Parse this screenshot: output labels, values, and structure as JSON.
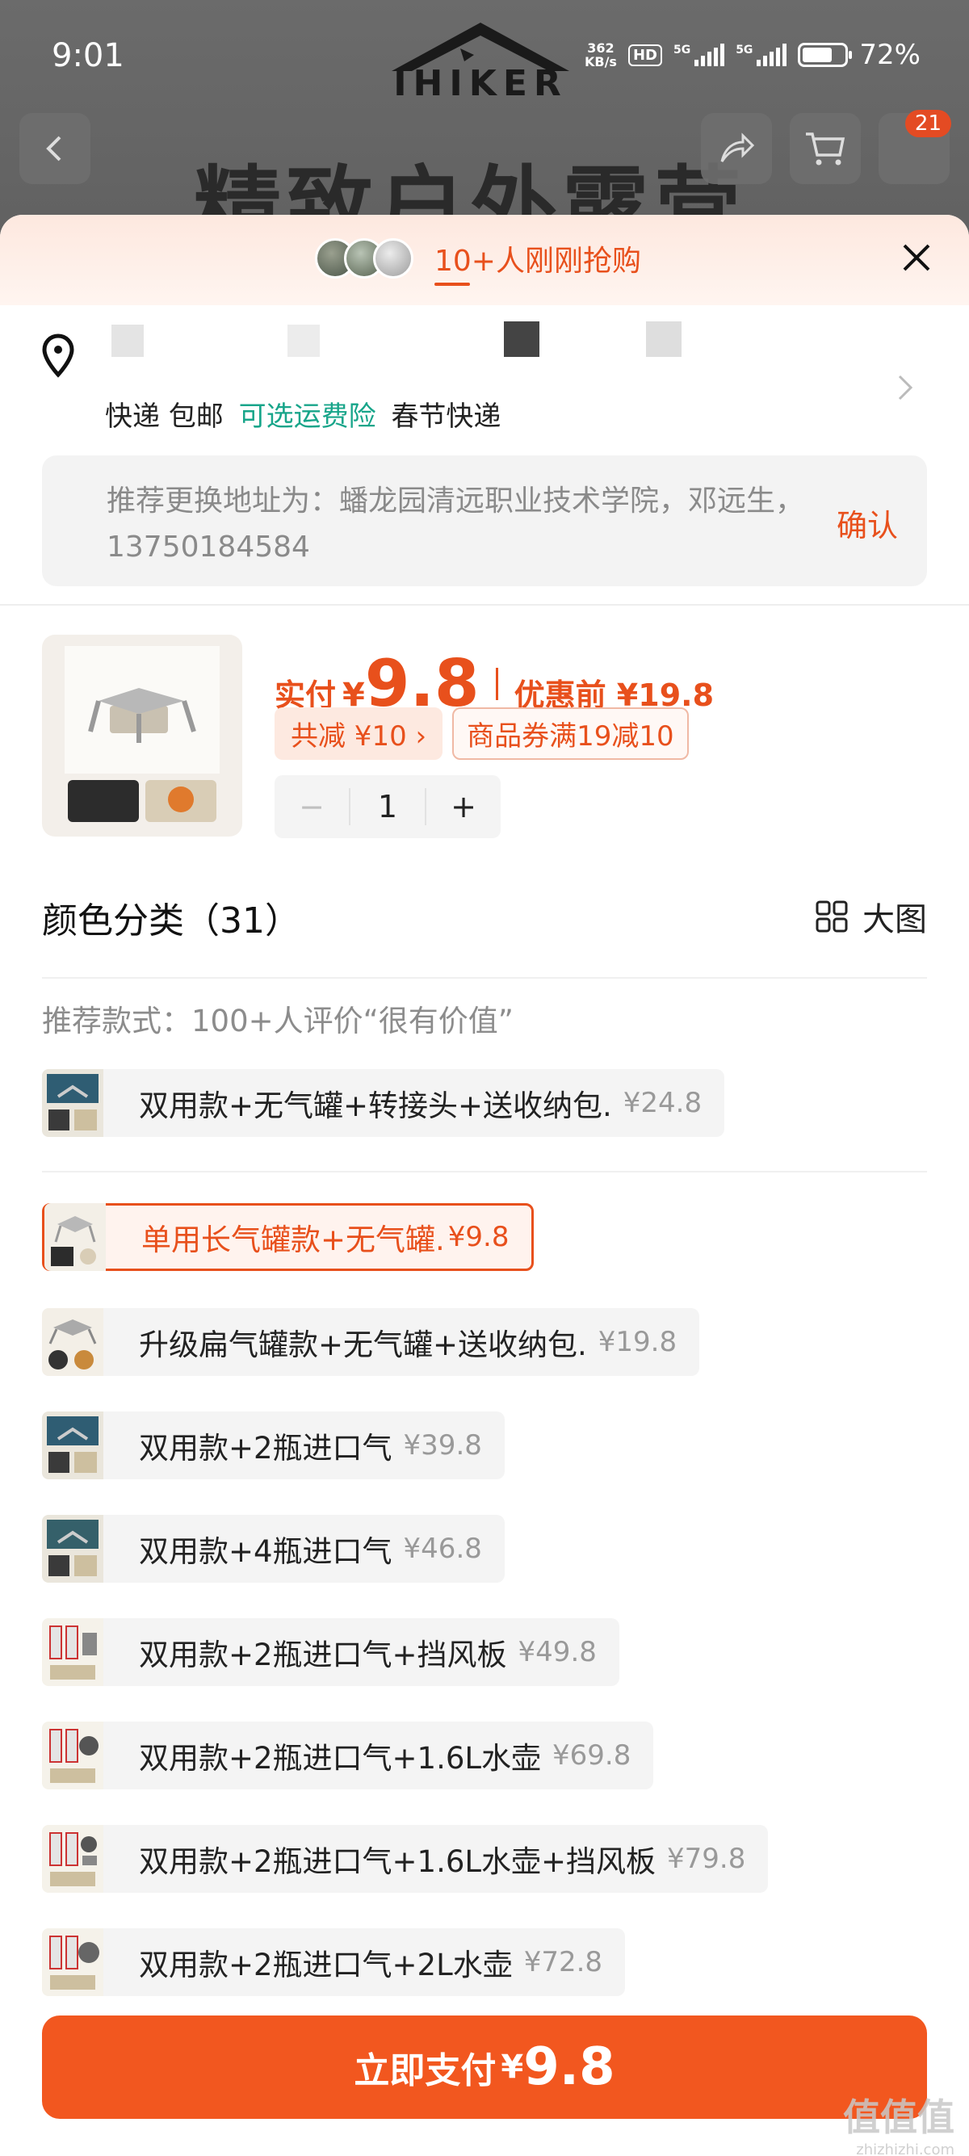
{
  "status_bar": {
    "time": "9:01",
    "net_speed": "362",
    "net_unit": "KB/s",
    "hd": "HD",
    "signal1": "5G",
    "signal2": "5G",
    "battery": "72%"
  },
  "background": {
    "brand": "IHIKER",
    "banner": "精致户外露营",
    "cart_badge": "21"
  },
  "sheet": {
    "rush_text": "10+人刚刚抢购",
    "shipping": {
      "express": "快递 包邮",
      "insurance": "可选运费险",
      "rest": "春节快递"
    },
    "suggest": {
      "text": "推荐更换地址为：蟠龙园清远职业技术学院，邓远生，13750184584",
      "confirm": "确认"
    },
    "price": {
      "label": "实付",
      "currency": "¥",
      "amount": "9.8",
      "before": "优惠前 ¥19.8",
      "save_tag": "共减 ¥10 ›",
      "coupon_tag": "商品券满19减10"
    },
    "quantity": "1",
    "stepper_minus": "−",
    "stepper_plus": "+",
    "color_title": "颜色分类（31）",
    "bigview": "大图",
    "recommend_label": "推荐款式：100+人评价“很有价值”",
    "options": [
      {
        "name": "双用款+无气罐+转接头+送收纳包.",
        "price": "¥24.8"
      },
      {
        "name": "单用长气罐款+无气罐.",
        "price": "¥9.8"
      },
      {
        "name": "升级扁气罐款+无气罐+送收纳包.",
        "price": "¥19.8"
      },
      {
        "name": "双用款+2瓶进口气",
        "price": "¥39.8"
      },
      {
        "name": "双用款+4瓶进口气",
        "price": "¥46.8"
      },
      {
        "name": "双用款+2瓶进口气+挡风板",
        "price": "¥49.8"
      },
      {
        "name": "双用款+2瓶进口气+1.6L水壶",
        "price": "¥69.8"
      },
      {
        "name": "双用款+2瓶进口气+1.6L水壶+挡风板",
        "price": "¥79.8"
      },
      {
        "name": "双用款+2瓶进口气+2L水壶",
        "price": "¥72.8"
      }
    ],
    "pay": {
      "label": "立即支付",
      "currency": "¥",
      "amount": "9.8"
    }
  },
  "watermark": {
    "main": "值值值",
    "sub": "zhizhizhi.com"
  },
  "colors": {
    "accent": "#e8501c",
    "pay_button": "#f2571f",
    "green": "#18a58a"
  }
}
